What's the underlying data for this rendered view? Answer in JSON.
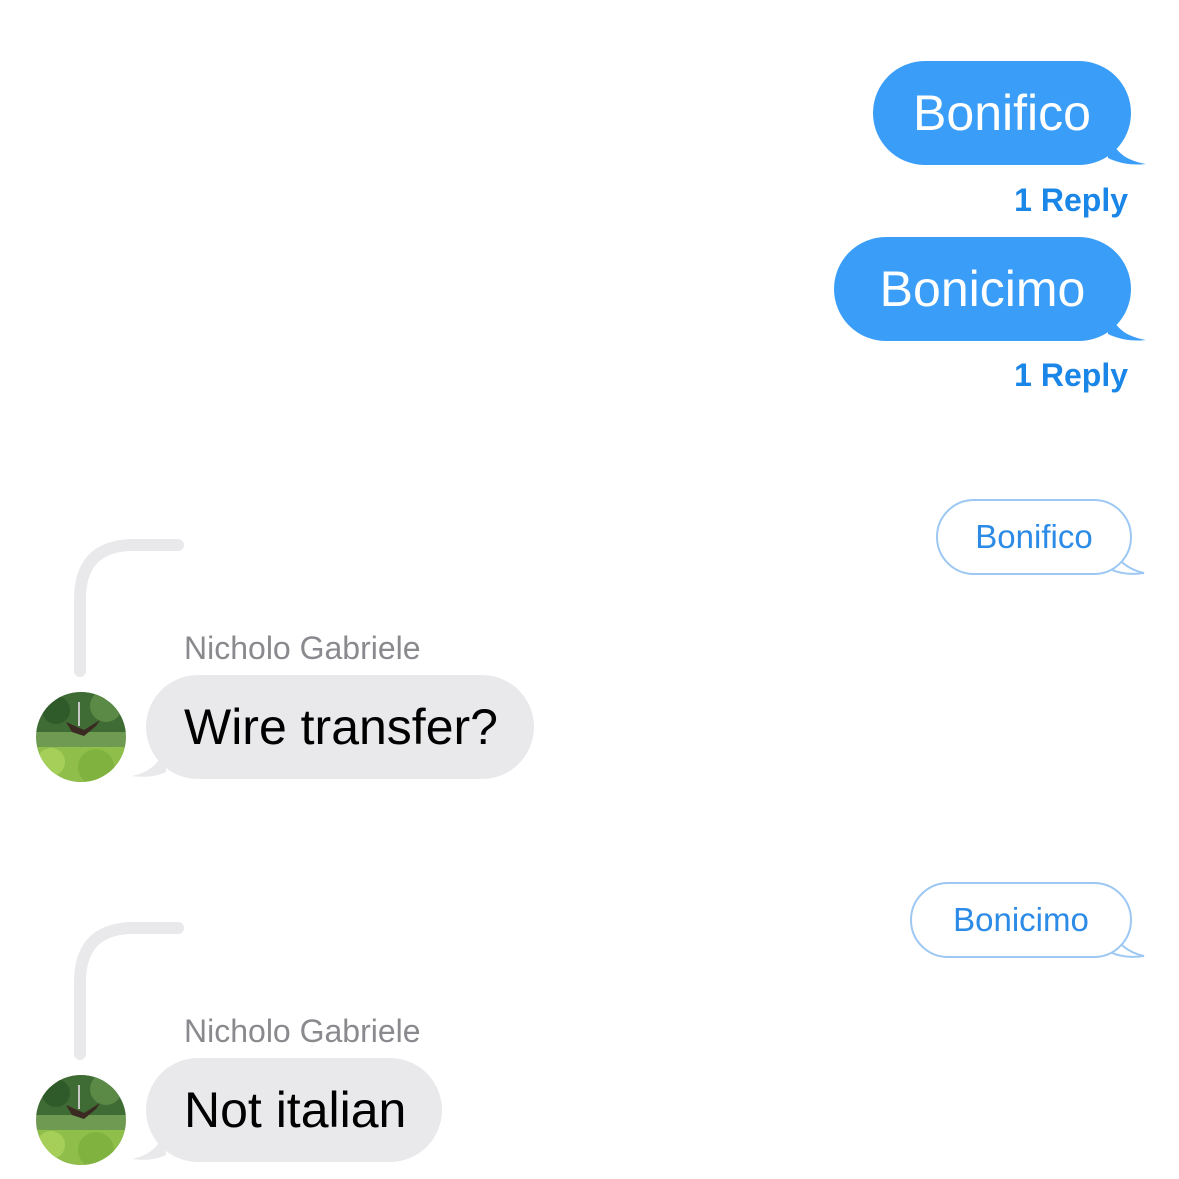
{
  "conversation": {
    "sent_messages": [
      {
        "text": "Bonifico",
        "reply_label": "1 Reply"
      },
      {
        "text": "Bonicimo",
        "reply_label": "1 Reply"
      }
    ],
    "threads": [
      {
        "quoted_text": "Bonifico",
        "sender_name": "Nicholo Gabriele",
        "reply_text": "Wire transfer?",
        "avatar_icon": "contact-photo-icon"
      },
      {
        "quoted_text": "Bonicimo",
        "sender_name": "Nicholo Gabriele",
        "reply_text": "Not italian",
        "avatar_icon": "contact-photo-icon"
      }
    ]
  },
  "colors": {
    "sent_bubble": "#3a9ef8",
    "received_bubble": "#e9e9eb",
    "reply_link": "#1a86e8",
    "quote_border": "#9cc8f3",
    "sender_name": "#8a8a8e"
  }
}
